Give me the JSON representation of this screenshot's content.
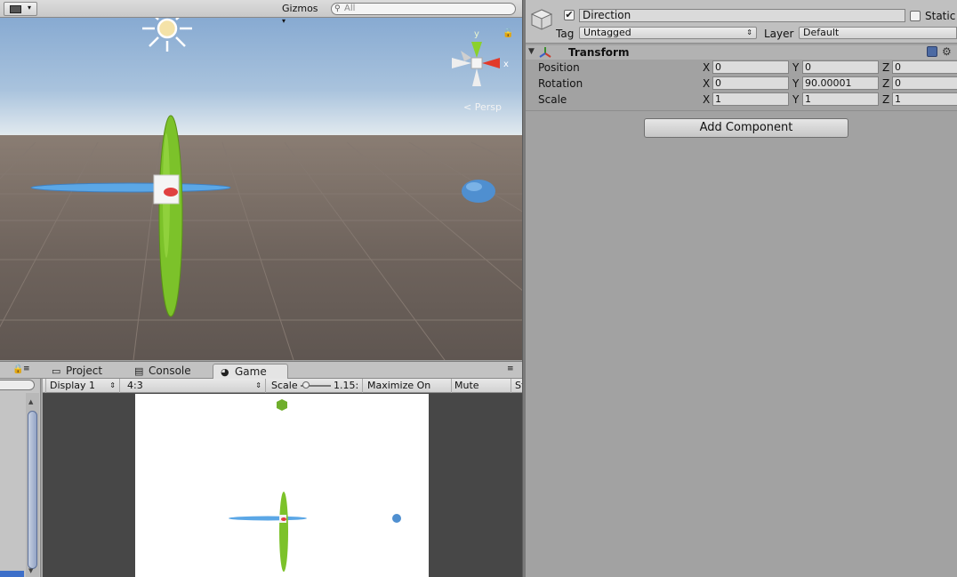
{
  "scene": {
    "gizmos_label": "Gizmos",
    "search_placeholder": "All",
    "gizmo_axis_y": "y",
    "gizmo_axis_x": "x",
    "persp_label": "Persp"
  },
  "bottom_tabs": {
    "project": "Project",
    "console": "Console",
    "game": "Game"
  },
  "game_toolbar": {
    "display": "Display 1",
    "aspect": "4:3",
    "scale_label": "Scale",
    "scale_value": "1.15:",
    "maximize": "Maximize On Play",
    "mute": "Mute Audio",
    "stats": "St"
  },
  "inspector": {
    "object_name": "Direction",
    "active": true,
    "static_label": "Static",
    "tag_label": "Tag",
    "tag_value": "Untagged",
    "layer_label": "Layer",
    "layer_value": "Default",
    "component_title": "Transform",
    "rows": [
      {
        "label": "Position",
        "x": "0",
        "y": "0",
        "z": "0"
      },
      {
        "label": "Rotation",
        "x": "0",
        "y": "90.00001",
        "z": "0"
      },
      {
        "label": "Scale",
        "x": "1",
        "y": "1",
        "z": "1"
      }
    ],
    "axis": {
      "x": "X",
      "y": "Y",
      "z": "Z"
    },
    "add_component": "Add Component"
  },
  "colors": {
    "green_capsule": "#7cc22a",
    "blue_disc": "#5ba7e6",
    "sphere_blue": "#4f8fd0",
    "red_axis": "#e23a2a",
    "selection_blue": "#3d6fc9"
  }
}
